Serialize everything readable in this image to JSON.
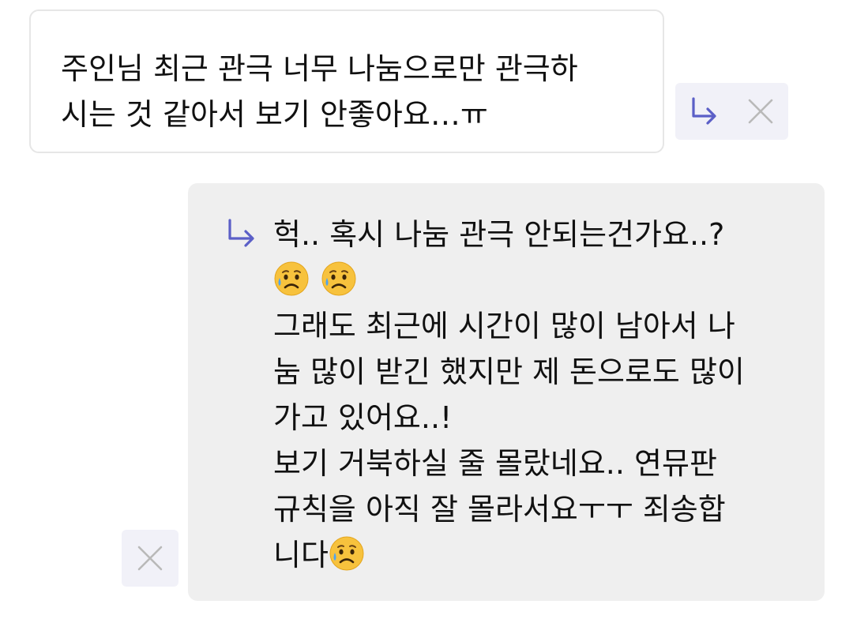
{
  "message": {
    "lines": [
      "주인님 최근 관극 너무 나눔으로만 관극하",
      "시는 것 같아서 보기 안좋아요…ㅠ"
    ]
  },
  "reply": {
    "line1": "헉.. 혹시 나눔 관극 안되는건가요..?",
    "line3": "그래도 최근에 시간이 많이 남아서 나",
    "line4": "눔 많이 받긴 했지만 제 돈으로도 많이",
    "line5": "가고 있어요..!",
    "line6": "보기 거북하실 줄 몰랐네요.. 연뮤판",
    "line7": "규칙을 아직 잘 몰라서요ㅜㅜ 죄송합",
    "line8_text": "니다",
    "emoji": "sad-relieved-face-emoji"
  },
  "actions": {
    "reply_icon": "reply-arrow-icon",
    "close_icon": "close-icon"
  },
  "colors": {
    "accent": "#5b5fc7",
    "reply_bg": "#efefef",
    "pill_bg": "#f1f1f8",
    "icon_gray": "#b9b9b9"
  }
}
